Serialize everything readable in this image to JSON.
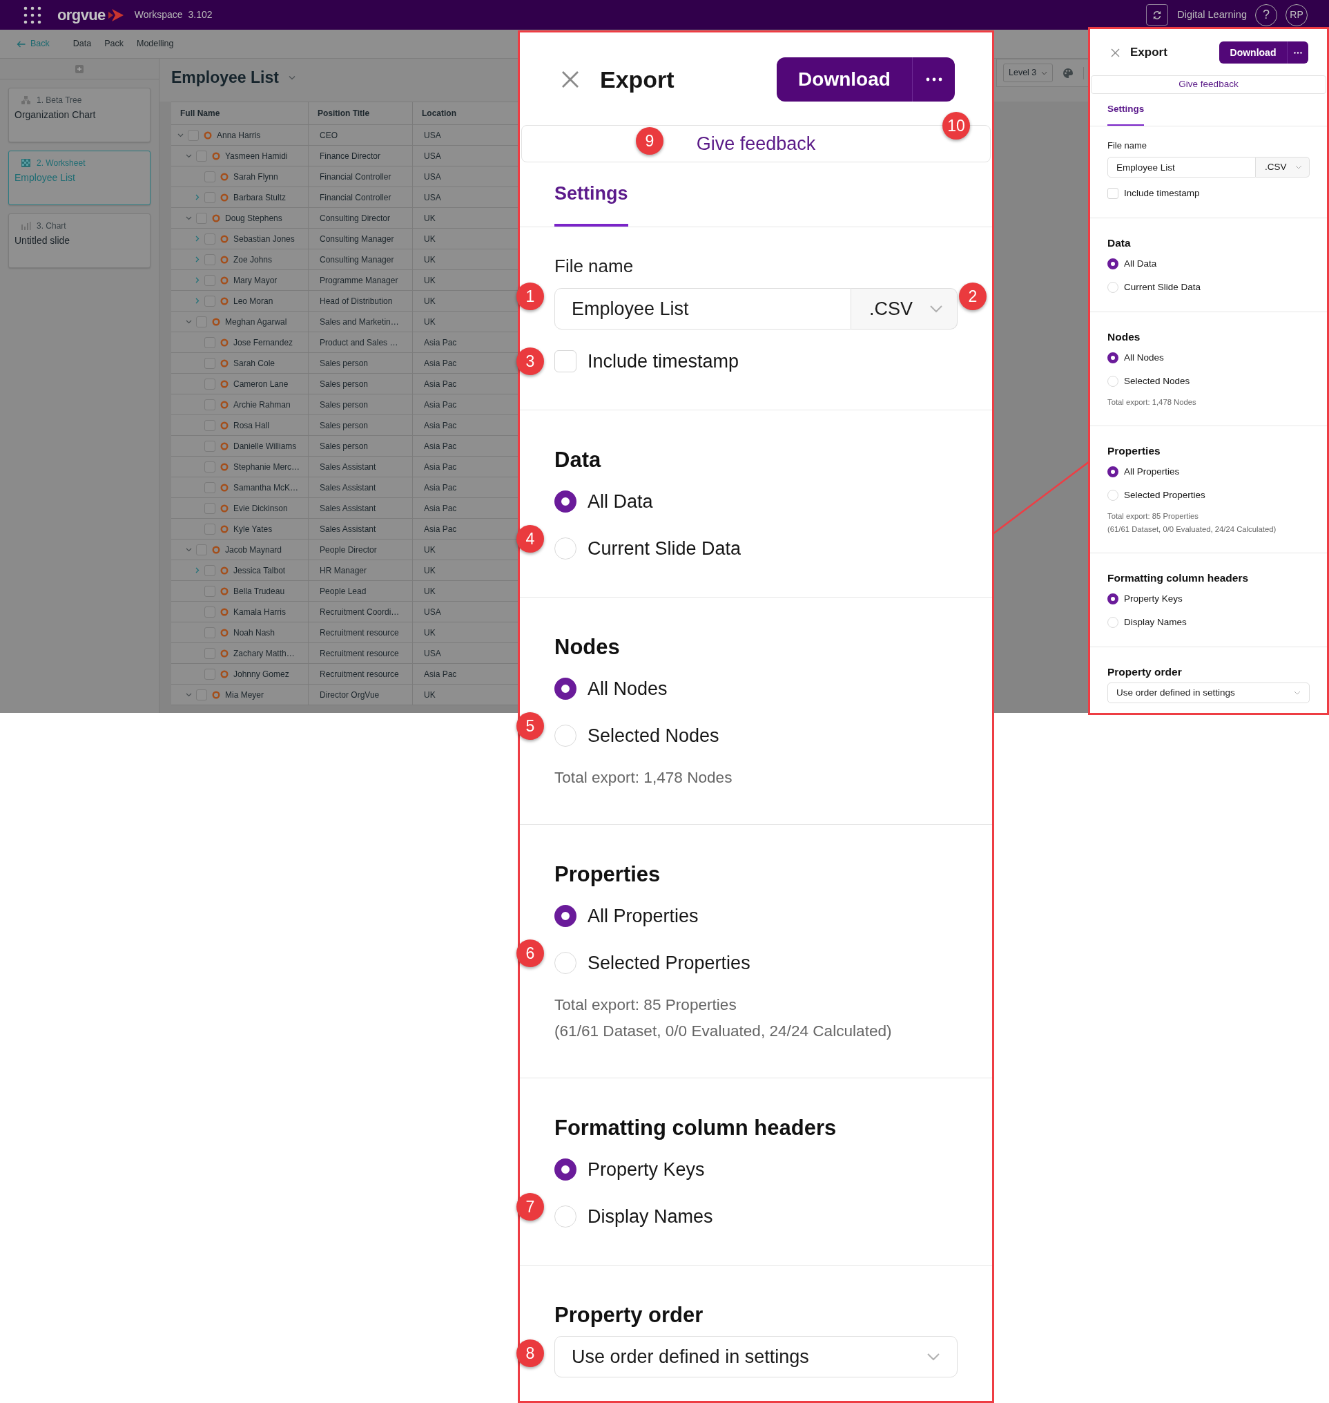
{
  "app": {
    "top_bar": {
      "logo": "orgvue",
      "workspace": "Workspace",
      "version": "3.102",
      "account": "Digital Learning",
      "help": "?",
      "avatar": "RP"
    },
    "nav": {
      "back": "Back",
      "links": [
        "Data",
        "Pack",
        "Modelling"
      ]
    },
    "slides": [
      {
        "kind": "tree",
        "label": "1. Beta Tree",
        "title": "Organization Chart",
        "selected": false
      },
      {
        "kind": "worksheet",
        "label": "2. Worksheet",
        "title": "Employee List",
        "selected": true
      },
      {
        "kind": "chart",
        "label": "3. Chart",
        "title": "Untitled slide",
        "selected": false
      }
    ],
    "sheet_title": "Employee List",
    "toolbar": {
      "level": "Level 3"
    },
    "table": {
      "columns": [
        "Full Name",
        "Position Title",
        "Location"
      ],
      "rows": [
        {
          "name": "Anna Harris",
          "position": "CEO",
          "location": "USA",
          "checked": false,
          "expanded": true,
          "children": [
            {
              "name": "Yasmeen Hamidi",
              "position": "Finance Director",
              "location": "USA",
              "checked": false,
              "expanded": true,
              "children": [
                {
                  "name": "Sarah Flynn",
                  "position": "Financial Controller",
                  "location": "USA",
                  "checked": false
                },
                {
                  "name": "Barbara Stultz",
                  "position": "Financial Controller",
                  "location": "USA",
                  "checked": false,
                  "expanded": false
                }
              ]
            },
            {
              "name": "Doug Stephens",
              "position": "Consulting Director",
              "location": "UK",
              "checked": false,
              "expanded": true,
              "children": [
                {
                  "name": "Sebastian Jones",
                  "position": "Consulting Manager",
                  "location": "UK",
                  "checked": false,
                  "expanded": false
                },
                {
                  "name": "Zoe Johns",
                  "position": "Consulting Manager",
                  "location": "UK",
                  "checked": false,
                  "expanded": false
                },
                {
                  "name": "Mary Mayor",
                  "position": "Programme Manager",
                  "location": "UK",
                  "checked": false,
                  "expanded": false
                },
                {
                  "name": "Leo Moran",
                  "position": "Head of Distribution",
                  "location": "UK",
                  "checked": false,
                  "expanded": false
                }
              ]
            },
            {
              "name": "Meghan Agarwal",
              "position": "Sales and Marketin…",
              "location": "UK",
              "checked": false,
              "expanded": true,
              "children": [
                {
                  "name": "Jose Fernandez",
                  "position": "Product and Sales …",
                  "location": "Asia Pac",
                  "checked": false
                },
                {
                  "name": "Sarah Cole",
                  "position": "Sales person",
                  "location": "Asia Pac",
                  "checked": false
                },
                {
                  "name": "Cameron Lane",
                  "position": "Sales person",
                  "location": "Asia Pac",
                  "checked": false
                },
                {
                  "name": "Archie Rahman",
                  "position": "Sales person",
                  "location": "Asia Pac",
                  "checked": false
                },
                {
                  "name": "Rosa Hall",
                  "position": "Sales person",
                  "location": "Asia Pac",
                  "checked": false
                },
                {
                  "name": "Danielle Williams",
                  "position": "Sales person",
                  "location": "Asia Pac",
                  "checked": false
                },
                {
                  "name": "Stephanie Merc…",
                  "position": "Sales Assistant",
                  "location": "Asia Pac",
                  "checked": false
                },
                {
                  "name": "Samantha McK…",
                  "position": "Sales Assistant",
                  "location": "Asia Pac",
                  "checked": false
                },
                {
                  "name": "Evie Dickinson",
                  "position": "Sales Assistant",
                  "location": "Asia Pac",
                  "checked": false
                },
                {
                  "name": "Kyle Yates",
                  "position": "Sales Assistant",
                  "location": "Asia Pac",
                  "checked": false
                }
              ]
            },
            {
              "name": "Jacob Maynard",
              "position": "People Director",
              "location": "UK",
              "checked": false,
              "expanded": true,
              "children": [
                {
                  "name": "Jessica Talbot",
                  "position": "HR Manager",
                  "location": "UK",
                  "checked": false,
                  "expanded": false
                },
                {
                  "name": "Bella Trudeau",
                  "position": "People Lead",
                  "location": "UK",
                  "checked": false
                },
                {
                  "name": "Kamala Harris",
                  "position": "Recruitment Coordi…",
                  "location": "USA",
                  "checked": false
                },
                {
                  "name": "Noah Nash",
                  "position": "Recruitment resource",
                  "location": "UK",
                  "checked": false
                },
                {
                  "name": "Zachary Matth…",
                  "position": "Recruitment resource",
                  "location": "USA",
                  "checked": false
                },
                {
                  "name": "Johnny Gomez",
                  "position": "Recruitment resource",
                  "location": "Asia Pac",
                  "checked": false
                }
              ]
            },
            {
              "name": "Mia Meyer",
              "position": "Director OrgVue",
              "location": "UK",
              "checked": false,
              "expanded": true
            }
          ]
        }
      ]
    }
  },
  "export_callout": {
    "title": "Export",
    "download": {
      "label": "Download"
    },
    "more_button": {
      "marker": "10"
    },
    "feedback": {
      "label": "Give feedback",
      "marker": "9"
    },
    "tabs": [
      {
        "label": "Settings",
        "selected": true
      }
    ],
    "file_name": {
      "label": "File name",
      "value": "Employee List",
      "marker": "1"
    },
    "format": {
      "value": ".CSV",
      "marker": "2"
    },
    "timestamp": {
      "label": "Include timestamp",
      "checked": false,
      "marker": "3"
    },
    "sections": [
      {
        "title": "Data",
        "marker": "4",
        "options": [
          {
            "label": "All Data",
            "selected": true
          },
          {
            "label": "Current Slide Data",
            "selected": false
          }
        ]
      },
      {
        "title": "Nodes",
        "marker": "5",
        "options": [
          {
            "label": "All Nodes",
            "selected": true
          },
          {
            "label": "Selected Nodes",
            "selected": false
          }
        ],
        "note": "Total export: 1,478 Nodes"
      },
      {
        "title": "Properties",
        "marker": "6",
        "options": [
          {
            "label": "All Properties",
            "selected": true
          },
          {
            "label": "Selected Properties",
            "selected": false
          }
        ],
        "note": "Total export: 85 Properties\n(61/61 Dataset, 0/0 Evaluated, 24/24 Calculated)"
      },
      {
        "title": "Formatting column headers",
        "marker": "7",
        "options": [
          {
            "label": "Property Keys",
            "selected": true
          },
          {
            "label": "Display Names",
            "selected": false
          }
        ]
      }
    ],
    "property_order": {
      "title": "Property order",
      "value": "Use order defined in settings",
      "marker": "8"
    }
  },
  "export_drawer": {
    "title": "Export",
    "download": {
      "label": "Download"
    },
    "feedback": {
      "label": "Give feedback"
    },
    "tabs": [
      {
        "label": "Settings",
        "selected": true
      }
    ],
    "file_name": {
      "label": "File name",
      "value": "Employee List"
    },
    "format": {
      "value": ".CSV"
    },
    "timestamp": {
      "label": "Include timestamp",
      "checked": false
    },
    "sections": [
      {
        "title": "Data",
        "options": [
          {
            "label": "All Data",
            "selected": true
          },
          {
            "label": "Current Slide Data",
            "selected": false
          }
        ]
      },
      {
        "title": "Nodes",
        "options": [
          {
            "label": "All Nodes",
            "selected": true
          },
          {
            "label": "Selected Nodes",
            "selected": false
          }
        ],
        "note": "Total export: 1,478 Nodes"
      },
      {
        "title": "Properties",
        "options": [
          {
            "label": "All Properties",
            "selected": true
          },
          {
            "label": "Selected Properties",
            "selected": false
          }
        ],
        "note": "Total export: 85 Properties\n(61/61 Dataset, 0/0 Evaluated, 24/24 Calculated)"
      },
      {
        "title": "Formatting column headers",
        "options": [
          {
            "label": "Property Keys",
            "selected": true
          },
          {
            "label": "Display Names",
            "selected": false
          }
        ]
      }
    ],
    "property_order": {
      "title": "Property order",
      "value": "Use order defined in settings"
    }
  }
}
